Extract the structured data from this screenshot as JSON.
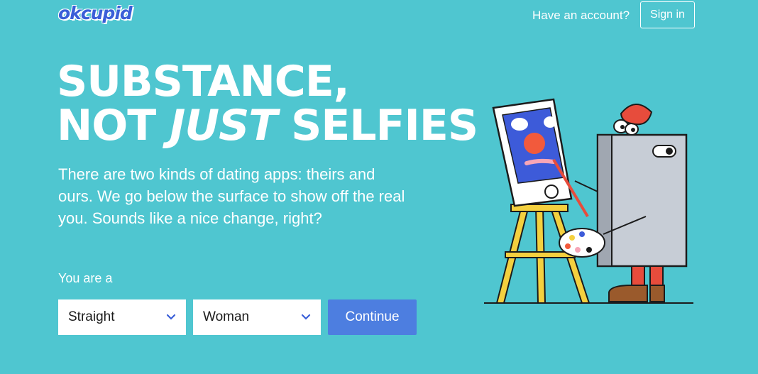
{
  "header": {
    "logo_text": "okcupid",
    "have_account_text": "Have an account?",
    "signin_label": "Sign in"
  },
  "hero": {
    "headline_line1": "SUBSTANCE,",
    "headline_line2_prefix": "NOT ",
    "headline_line2_emphasis": "JUST",
    "headline_line2_suffix": " SELFIES",
    "intro": "There are two kinds of dating apps: theirs and ours. We go below the surface to show off the real you. Sounds like a nice change, right?"
  },
  "form": {
    "you_are_label": "You are a",
    "orientation_selected": "Straight",
    "gender_selected": "Woman",
    "continue_label": "Continue"
  },
  "illustration": {
    "icon": "painter-robot-easel-illustration"
  },
  "colors": {
    "background": "#4fc6d0",
    "button": "#4d7ee0",
    "logo": "#3a5fd8"
  }
}
